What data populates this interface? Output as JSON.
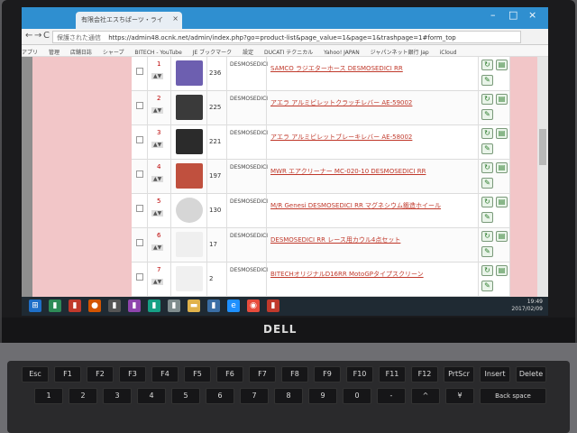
{
  "browser": {
    "tab_title": "有限会社エスちぱーツ・ライ",
    "tab_close": "×",
    "window_buttons": [
      "–",
      "□",
      "×"
    ],
    "nav_buttons": [
      "←",
      "→",
      "C"
    ],
    "secure_label": "保護された通信",
    "url": "https://admin48.ocnk.net/admin/index.php?go=product-list&page_value=1&page=1&trashpage=1#form_top",
    "bookmarks": [
      "アプリ",
      "管理",
      "店舗日誌",
      "シャープ",
      "BITECH - YouTube",
      "JE ブックマーク",
      "設定",
      "DUCATI テクニカル",
      "Yahoo! JAPAN",
      "ジャパンネット銀行 Jap",
      "iCloud"
    ]
  },
  "product_rows": [
    {
      "num": "1",
      "id": "236",
      "model": "DESMOSEDICI",
      "name": "SAMCO ラジエターホース DESMOSEDICI RR"
    },
    {
      "num": "2",
      "id": "225",
      "model": "DESMOSEDICI",
      "name": "アエラ アルミビレットクラッチレバー AE-59002"
    },
    {
      "num": "3",
      "id": "221",
      "model": "DESMOSEDICI",
      "name": "アエラ アルミビレットブレーキレバー AE-58002"
    },
    {
      "num": "4",
      "id": "197",
      "model": "DESMOSEDICI",
      "name": "MWR エアクリーナー MC-020-10 DESMOSEDICI RR"
    },
    {
      "num": "5",
      "id": "130",
      "model": "DESMOSEDICI",
      "name": "M/R Genesi DESMOSEDICI RR マグネシウム鍛造ホイール"
    },
    {
      "num": "6",
      "id": "17",
      "model": "DESMOSEDICI",
      "name": "DESMOSEDICI RR レース用カウル4点セット"
    },
    {
      "num": "7",
      "id": "2",
      "model": "DESMOSEDICI",
      "name": "BITECHオリジナルD16RR MotoGPタイプスクリーン"
    }
  ],
  "taskbar": {
    "clock_time": "19:49",
    "clock_date": "2017/02/09"
  },
  "laptop": {
    "brand": "DELL"
  },
  "keys": [
    {
      "label": "Esc"
    },
    {
      "label": "F1"
    },
    {
      "label": "F2"
    },
    {
      "label": "F3"
    },
    {
      "label": "F4"
    },
    {
      "label": "F5"
    },
    {
      "label": "F6"
    },
    {
      "label": "F7"
    },
    {
      "label": "F8"
    },
    {
      "label": "F9"
    },
    {
      "label": "F10"
    },
    {
      "label": "F11"
    },
    {
      "label": "F12"
    },
    {
      "label": "PrtScr"
    },
    {
      "label": "Insert"
    },
    {
      "label": "Delete"
    },
    {
      "label": "1"
    },
    {
      "label": "2"
    },
    {
      "label": "3"
    },
    {
      "label": "4"
    },
    {
      "label": "5"
    },
    {
      "label": "6"
    },
    {
      "label": "7"
    },
    {
      "label": "8"
    },
    {
      "label": "9"
    },
    {
      "label": "0"
    },
    {
      "label": "-"
    },
    {
      "label": "^"
    },
    {
      "label": "¥"
    },
    {
      "label": "Back space"
    }
  ]
}
